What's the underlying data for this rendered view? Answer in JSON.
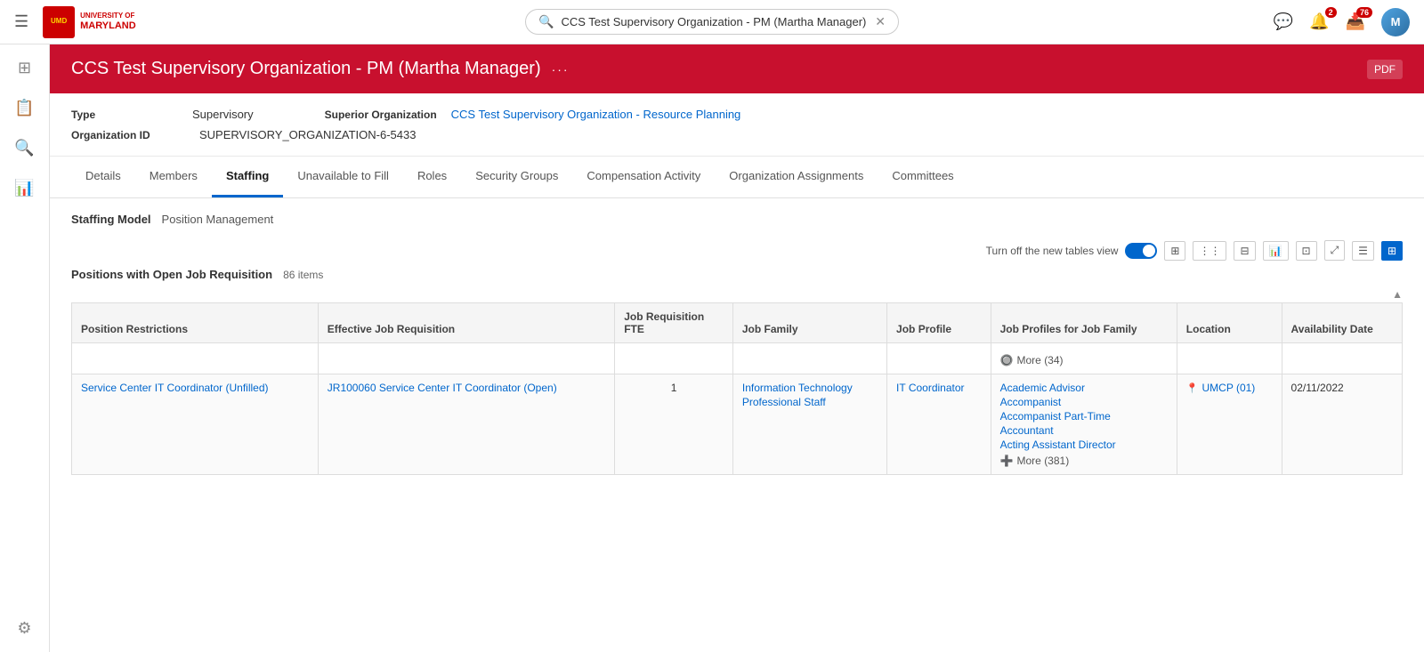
{
  "topNav": {
    "hamburger": "☰",
    "logo": {
      "line1": "UNIVERSITY OF",
      "line2": "MARYLAND"
    },
    "search": {
      "placeholder": "",
      "value": "CCS Test Supervisory Organization - PM (Martha Manager)"
    },
    "notifications": {
      "chat_label": "💬",
      "bell_label": "🔔",
      "bell_count": "2",
      "inbox_label": "📥",
      "inbox_count": "76",
      "avatar_initials": "M"
    }
  },
  "sidebar": {
    "icons": [
      {
        "name": "grid-icon",
        "symbol": "⊞",
        "active": false
      },
      {
        "name": "report-icon",
        "symbol": "📋",
        "active": false
      },
      {
        "name": "search-icon",
        "symbol": "🔍",
        "active": false
      },
      {
        "name": "chart-icon",
        "symbol": "📊",
        "active": false
      },
      {
        "name": "settings-icon",
        "symbol": "⚙",
        "active": false
      }
    ]
  },
  "pageHeader": {
    "title": "CCS Test Supervisory Organization - PM (Martha Manager)",
    "pdf_label": "PDF"
  },
  "infoSection": {
    "type_label": "Type",
    "type_value": "Supervisory",
    "superior_org_label": "Superior Organization",
    "superior_org_link": "CCS Test Supervisory Organization - Resource Planning",
    "org_id_label": "Organization ID",
    "org_id_value": "SUPERVISORY_ORGANIZATION-6-5433"
  },
  "tabs": [
    {
      "id": "details",
      "label": "Details",
      "active": false
    },
    {
      "id": "members",
      "label": "Members",
      "active": false
    },
    {
      "id": "staffing",
      "label": "Staffing",
      "active": true
    },
    {
      "id": "unavailable",
      "label": "Unavailable to Fill",
      "active": false
    },
    {
      "id": "roles",
      "label": "Roles",
      "active": false
    },
    {
      "id": "security-groups",
      "label": "Security Groups",
      "active": false
    },
    {
      "id": "compensation",
      "label": "Compensation Activity",
      "active": false
    },
    {
      "id": "org-assignments",
      "label": "Organization Assignments",
      "active": false
    },
    {
      "id": "committees",
      "label": "Committees",
      "active": false
    }
  ],
  "staffingModel": {
    "label": "Staffing Model",
    "value": "Position Management"
  },
  "tableControls": {
    "toggle_label": "Turn off the new tables view"
  },
  "positionsTable": {
    "title": "Positions with Open Job Requisition",
    "item_count": "86 items",
    "columns": [
      "Position Restrictions",
      "Effective Job Requisition",
      "Job Requisition FTE",
      "Job Family",
      "Job Profile",
      "Job Profiles for Job Family",
      "Location",
      "Availability Date"
    ],
    "rows": [
      {
        "position_restriction": "",
        "effective_job_req": "",
        "fte": "",
        "job_family": "",
        "job_profile": "",
        "job_profiles_for_family": "🔘 More (34)",
        "location": "",
        "availability_date": ""
      },
      {
        "position_restriction": "Service Center IT Coordinator (Unfilled)",
        "position_restriction_link": true,
        "effective_job_req": "JR100060 Service Center IT Coordinator (Open)",
        "effective_job_req_link": true,
        "fte": "1",
        "job_family_line1": "Information Technology",
        "job_family_line2": "Professional Staff",
        "job_family_link": true,
        "job_profile": "IT Coordinator",
        "job_profile_link": true,
        "job_profiles_list": [
          {
            "label": "Academic Advisor",
            "link": true
          },
          {
            "label": "Accompanist",
            "link": true
          },
          {
            "label": "Accompanist Part-Time",
            "link": true
          },
          {
            "label": "Accountant",
            "link": true
          },
          {
            "label": "Acting Assistant Director",
            "link": true
          },
          {
            "label": "More (381)",
            "is_more": true
          }
        ],
        "location": "UMCP (01)",
        "location_link": true,
        "availability_date": "02/11/2022"
      }
    ]
  }
}
